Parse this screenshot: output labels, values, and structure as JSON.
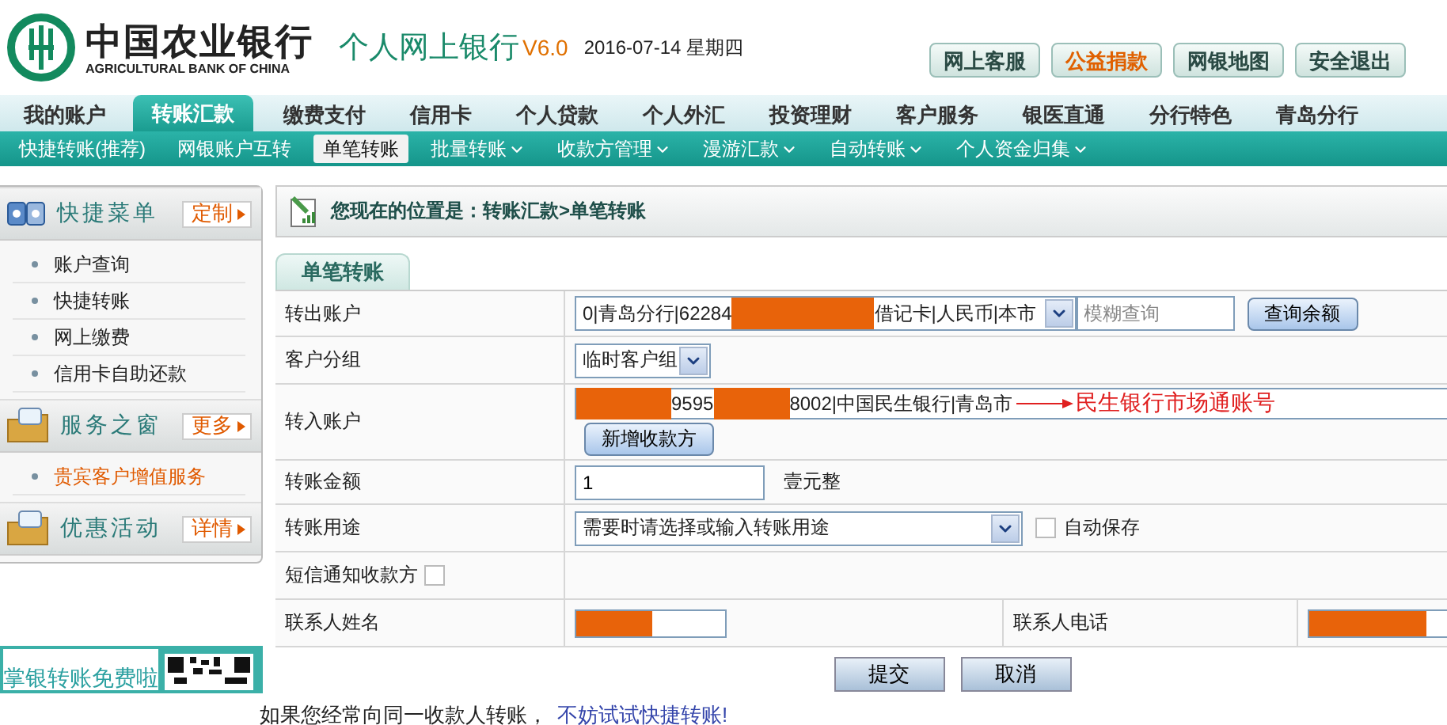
{
  "header": {
    "logo_cn": "中国农业银行",
    "logo_en": "AGRICULTURAL BANK OF CHINA",
    "product": "个人网上银行",
    "version": "V6.0",
    "date": "2016-07-14 星期四",
    "buttons": [
      {
        "label": "网上客服",
        "highlight": false
      },
      {
        "label": "公益捐款",
        "highlight": true
      },
      {
        "label": "网银地图",
        "highlight": false
      },
      {
        "label": "安全退出",
        "highlight": false
      }
    ]
  },
  "nav": [
    {
      "label": "我的账户",
      "selected": false
    },
    {
      "label": "转账汇款",
      "selected": true
    },
    {
      "label": "缴费支付",
      "selected": false
    },
    {
      "label": "信用卡",
      "selected": false
    },
    {
      "label": "个人贷款",
      "selected": false
    },
    {
      "label": "个人外汇",
      "selected": false
    },
    {
      "label": "投资理财",
      "selected": false
    },
    {
      "label": "客户服务",
      "selected": false
    },
    {
      "label": "银医直通",
      "selected": false
    },
    {
      "label": "分行特色",
      "selected": false
    },
    {
      "label": "青岛分行",
      "selected": false
    }
  ],
  "subnav": [
    {
      "label": "快捷转账(推荐)",
      "selected": false,
      "dropdown": false
    },
    {
      "label": "网银账户互转",
      "selected": false,
      "dropdown": false
    },
    {
      "label": "单笔转账",
      "selected": true,
      "dropdown": false
    },
    {
      "label": "批量转账",
      "selected": false,
      "dropdown": true
    },
    {
      "label": "收款方管理",
      "selected": false,
      "dropdown": true
    },
    {
      "label": "漫游汇款",
      "selected": false,
      "dropdown": true
    },
    {
      "label": "自动转账",
      "selected": false,
      "dropdown": true
    },
    {
      "label": "个人资金归集",
      "selected": false,
      "dropdown": true
    }
  ],
  "sidebar": {
    "sections": [
      {
        "title": "快捷菜单",
        "button": "定制",
        "kind": "cards",
        "items": [
          {
            "label": "账户查询",
            "highlight": false
          },
          {
            "label": "快捷转账",
            "highlight": false
          },
          {
            "label": "网上缴费",
            "highlight": false
          },
          {
            "label": "信用卡自助还款",
            "highlight": false
          }
        ]
      },
      {
        "title": "服务之窗",
        "button": "更多",
        "kind": "folder",
        "items": [
          {
            "label": "贵宾客户增值服务",
            "highlight": true
          }
        ]
      },
      {
        "title": "优惠活动",
        "button": "详情",
        "kind": "folder"
      }
    ],
    "banner": "掌银转账免费啦"
  },
  "breadcrumb": "您现在的位置是：转账汇款>单笔转账",
  "form_tab": "单笔转账",
  "form": {
    "rows": [
      {
        "kind": "account",
        "label": "转出账户",
        "parts": [
          {
            "kind": "text",
            "text": "0|青岛分行|62284"
          },
          {
            "kind": "redacted"
          },
          {
            "kind": "text",
            "text": "借记卡|人民币|本市"
          }
        ],
        "search_placeholder": "模糊查询",
        "button": "查询余额"
      },
      {
        "kind": "select",
        "label": "客户分组",
        "value": "临时客户组"
      },
      {
        "kind": "payee",
        "label": "转入账户",
        "parts": [
          {
            "kind": "redacted"
          },
          {
            "kind": "text",
            "text": "9595"
          },
          {
            "kind": "redacted"
          },
          {
            "kind": "text",
            "text": "8002|中国民生银行|青岛市"
          }
        ],
        "annotation": "民生银行市场通账号",
        "button": "新增收款方"
      },
      {
        "kind": "amount",
        "label": "转账金额",
        "value": "1",
        "words": "壹元整"
      },
      {
        "kind": "purpose",
        "label": "转账用途",
        "value": "需要时请选择或输入转账用途",
        "checkbox": {
          "label": "自动保存",
          "checked": false
        }
      },
      {
        "kind": "sms",
        "label": "短信通知收款方",
        "checked": false
      }
    ],
    "contacts": [
      {
        "label": "联系人姓名",
        "redacted": true
      },
      {
        "label": "联系人电话",
        "redacted": true
      }
    ]
  },
  "actions": [
    "提交",
    "取消"
  ],
  "tip": {
    "text": "如果您经常向同一收款人转账，",
    "link": "不妨试试快捷转账!"
  }
}
